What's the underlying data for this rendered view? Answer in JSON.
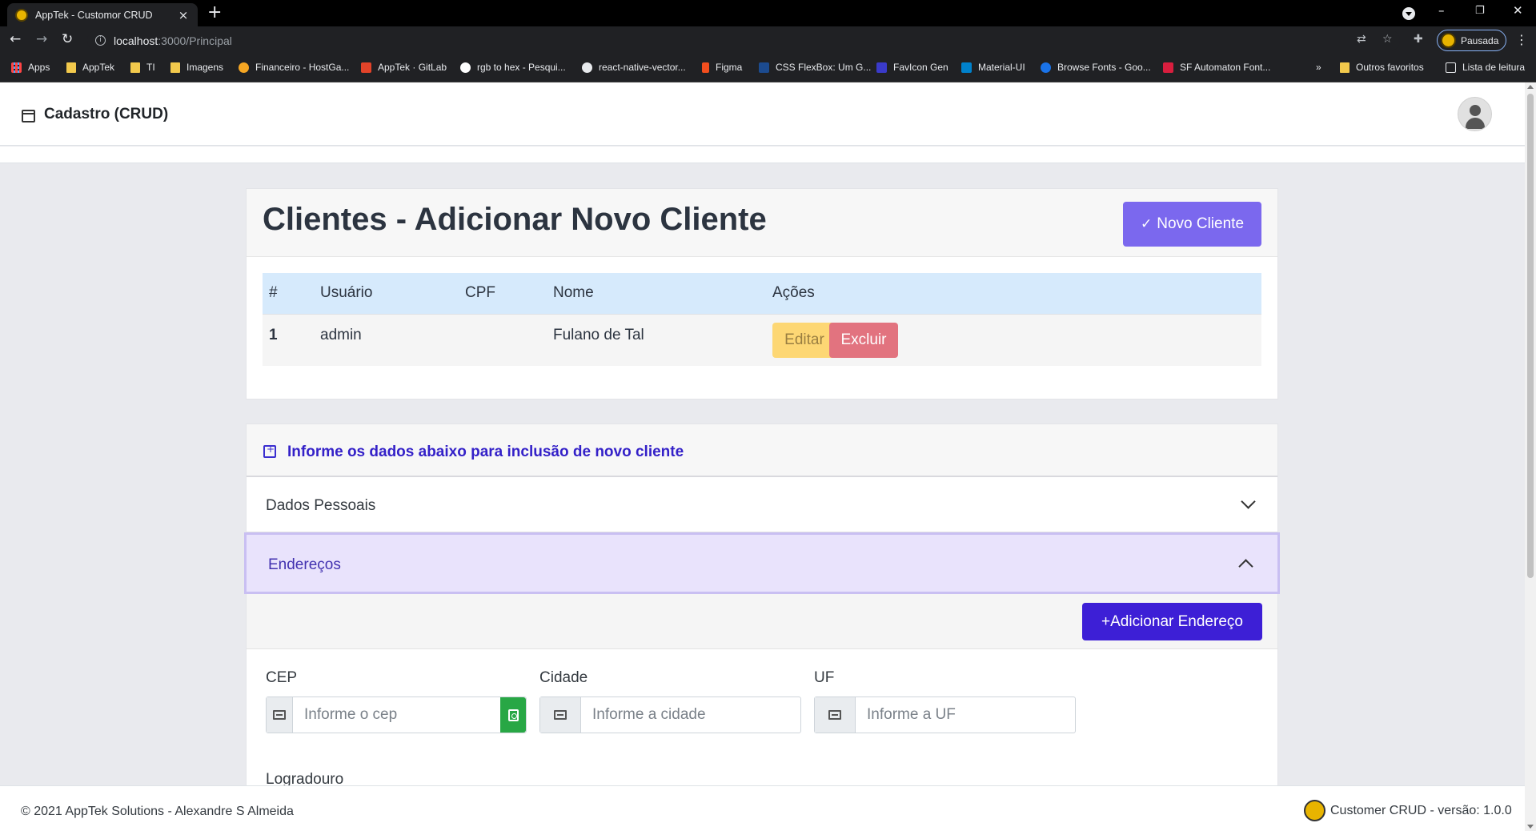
{
  "browser": {
    "tab_title": "AppTek - Customor CRUD",
    "url_host": "localhost",
    "url_path": ":3000/Principal",
    "profile_status": "Pausada",
    "bookmarks": [
      {
        "label": "Apps",
        "icon": "apps-grid-icon"
      },
      {
        "label": "AppTek",
        "icon": "folder-icon"
      },
      {
        "label": "TI",
        "icon": "folder-icon"
      },
      {
        "label": "Imagens",
        "icon": "folder-icon"
      },
      {
        "label": "Financeiro - HostGa...",
        "icon": "hostgator-icon"
      },
      {
        "label": "AppTek · GitLab",
        "icon": "gitlab-icon"
      },
      {
        "label": "rgb to hex - Pesqui...",
        "icon": "google-icon"
      },
      {
        "label": "react-native-vector...",
        "icon": "github-icon"
      },
      {
        "label": "Figma",
        "icon": "figma-icon"
      },
      {
        "label": "CSS FlexBox: Um G...",
        "icon": "alura-icon"
      },
      {
        "label": "FavIcon Gen",
        "icon": "favicon-gen-icon"
      },
      {
        "label": "Material-UI",
        "icon": "material-ui-icon"
      },
      {
        "label": "Browse Fonts - Goo...",
        "icon": "google-fonts-icon"
      },
      {
        "label": "SF Automaton Font...",
        "icon": "font-icon"
      }
    ],
    "overflow_label": "»",
    "other_bookmarks": "Outros favoritos",
    "reading_list": "Lista de leitura"
  },
  "header": {
    "title": "Cadastro (CRUD)"
  },
  "clientes": {
    "title": "Clientes - Adicionar Novo Cliente",
    "novo_button": "Novo Cliente",
    "columns": [
      "#",
      "Usuário",
      "CPF",
      "Nome",
      "Ações"
    ],
    "rows": [
      {
        "id": "1",
        "usuario": "admin",
        "cpf": "",
        "nome": "Fulano de Tal"
      }
    ],
    "edit_label": "Editar",
    "delete_label": "Excluir"
  },
  "form": {
    "info_text": "Informe os dados abaixo para inclusão de novo cliente",
    "sections": {
      "dados_pessoais": "Dados Pessoais",
      "enderecos": "Endereços"
    },
    "add_address_button": "+Adicionar Endereço",
    "fields": {
      "cep": {
        "label": "CEP",
        "placeholder": "Informe o cep",
        "value": ""
      },
      "cidade": {
        "label": "Cidade",
        "placeholder": "Informe a cidade",
        "value": ""
      },
      "uf": {
        "label": "UF",
        "placeholder": "Informe a UF",
        "value": ""
      },
      "logradouro": {
        "label": "Logradouro"
      }
    }
  },
  "footer": {
    "copyright": "© 2021 AppTek Solutions - Alexandre S Almeida",
    "version": "Customer CRUD - versão: 1.0.0"
  },
  "colors": {
    "primary_purple": "#7b68ee",
    "add_button": "#3d1fd6",
    "table_header": "#d6eafc",
    "edit_button": "#ffd25e",
    "delete_button": "#e2737f",
    "success_green": "#28a745"
  }
}
